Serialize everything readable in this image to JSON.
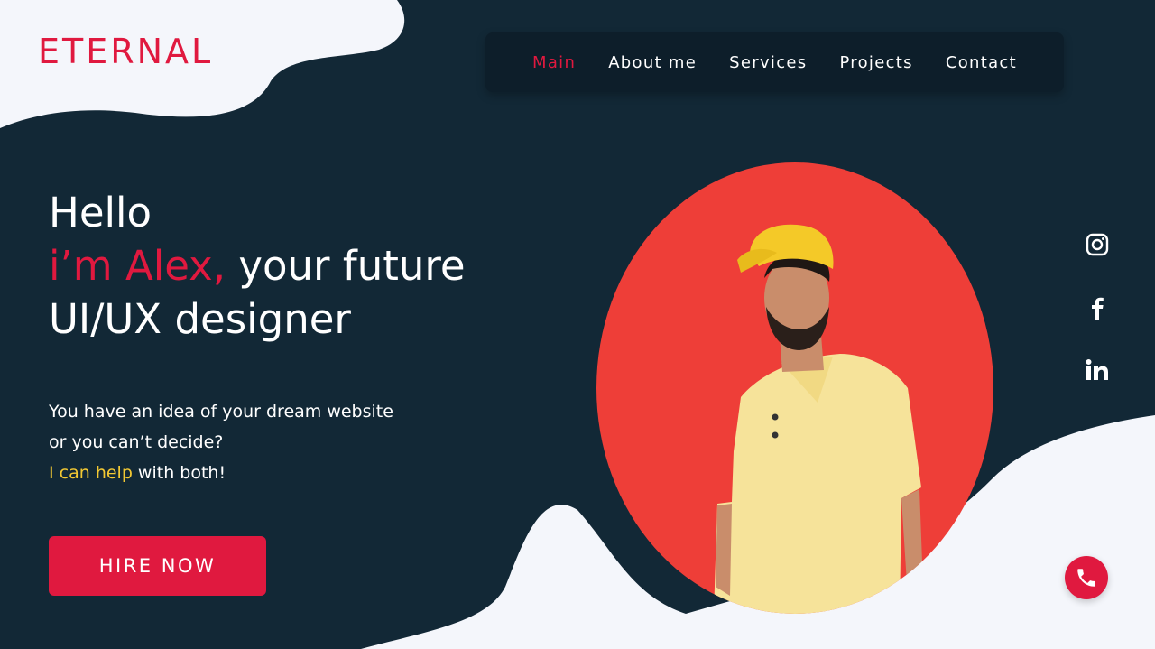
{
  "brand": {
    "logo": "ETERNAL"
  },
  "nav": {
    "items": [
      {
        "label": "Main",
        "active": true
      },
      {
        "label": "About me",
        "active": false
      },
      {
        "label": "Services",
        "active": false
      },
      {
        "label": "Projects",
        "active": false
      },
      {
        "label": "Contact",
        "active": false
      }
    ]
  },
  "hero": {
    "line1": "Hello",
    "accent": "i’m Alex,",
    "line2_rest": " your future",
    "line3": "UI/UX designer",
    "desc1": "You have an idea of your dream website",
    "desc2": "or you can’t decide?",
    "help_highlight": "I can help",
    "help_rest": " with both!",
    "cta": "HIRE NOW"
  },
  "social": [
    "instagram-icon",
    "facebook-icon",
    "linkedin-icon"
  ],
  "call": {
    "icon": "phone-icon"
  },
  "colors": {
    "background": "#122836",
    "accent": "#e0193f",
    "highlight": "#f3c933",
    "light_wave": "#f4f6fb",
    "portrait_circle": "#ee3e38"
  }
}
